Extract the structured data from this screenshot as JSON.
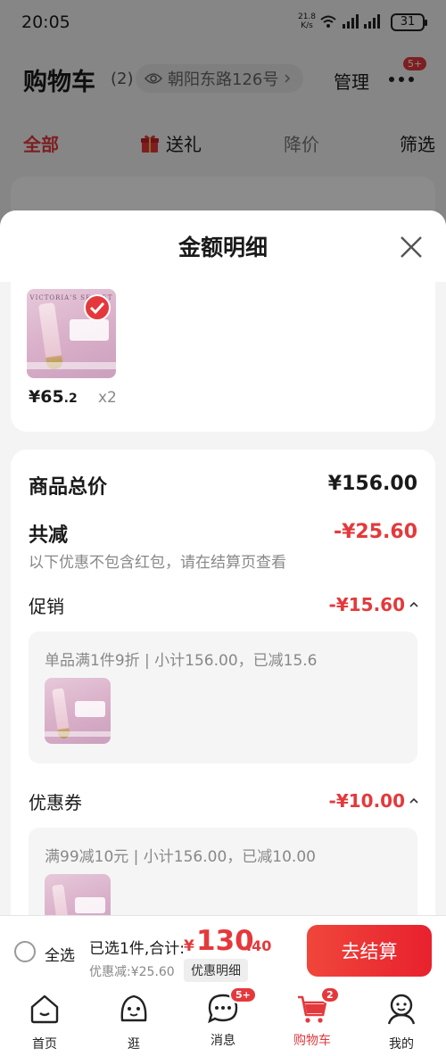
{
  "status_bar": {
    "time": "20:05",
    "speed": "21.8",
    "speed_unit": "K/s",
    "speed_extra": "6",
    "battery": "31"
  },
  "header": {
    "title": "购物车",
    "count": "(2)",
    "address": "朝阳东路126号",
    "manage": "管理",
    "more_badge": "5+"
  },
  "tabs": {
    "all": "全部",
    "gift": "送礼",
    "price_drop": "降价",
    "filter": "筛选"
  },
  "sheet": {
    "title": "金额明细",
    "product": {
      "brand": "VICTORIA'S SECRET",
      "price_main": "¥65",
      "price_decimal": ".2",
      "quantity": "x2"
    },
    "total_label": "商品总价",
    "total_value": "¥156.00",
    "reduce_label": "共减",
    "reduce_value": "-¥25.60",
    "note": "以下优惠不包含红包，请在结算页查看",
    "promo_label": "促销",
    "promo_value": "-¥15.60",
    "promo_desc": "单品满1件9折 | 小计156.00，已减15.6",
    "coupon_label": "优惠券",
    "coupon_value": "-¥10.00",
    "coupon_desc": "满99减10元 | 小计156.00，已减10.00"
  },
  "checkout": {
    "select_all": "全选",
    "selected_info": "已选1件,合计:",
    "currency": "¥",
    "total_int": "130",
    "total_dec": ".40",
    "discount_info": "优惠减:¥25.60",
    "detail_link": "优惠明细",
    "checkout_button": "去结算"
  },
  "nav": [
    {
      "label": "首页",
      "icon": "home-icon"
    },
    {
      "label": "逛",
      "icon": "browse-face-icon"
    },
    {
      "label": "消息",
      "icon": "message-icon",
      "badge": "5+"
    },
    {
      "label": "购物车",
      "icon": "cart-icon",
      "badge": "2"
    },
    {
      "label": "我的",
      "icon": "profile-icon"
    }
  ],
  "colors": {
    "accent": "#e4393c",
    "overlay": "rgba(0,0,0,0.45)"
  }
}
